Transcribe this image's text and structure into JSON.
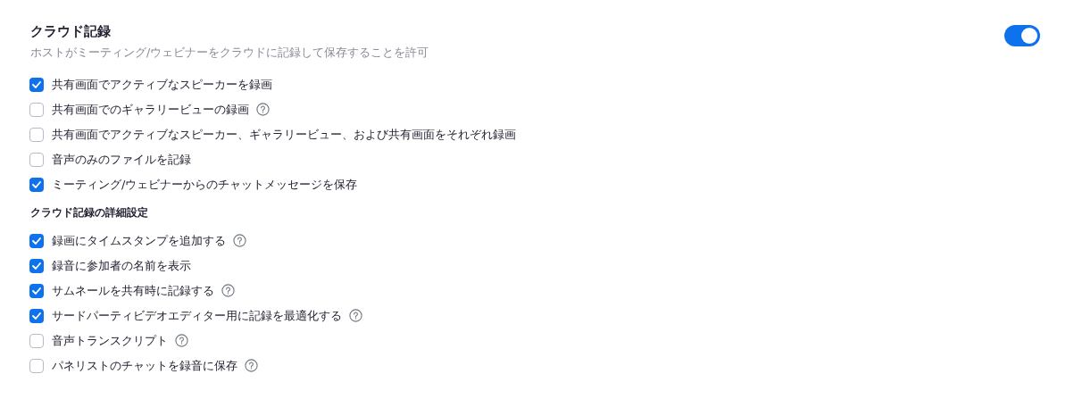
{
  "title": "クラウド記録",
  "description": "ホストがミーティング/ウェビナーをクラウドに記録して保存することを許可",
  "toggle": {
    "on": true
  },
  "options": [
    {
      "label": "共有画面でアクティブなスピーカーを録画",
      "checked": true,
      "help": false
    },
    {
      "label": "共有画面でのギャラリービューの録画",
      "checked": false,
      "help": true
    },
    {
      "label": "共有画面でアクティブなスピーカー、ギャラリービュー、および共有画面をそれぞれ録画",
      "checked": false,
      "help": false
    },
    {
      "label": "音声のみのファイルを記録",
      "checked": false,
      "help": false
    },
    {
      "label": "ミーティング/ウェビナーからのチャットメッセージを保存",
      "checked": true,
      "help": false
    }
  ],
  "advanced": {
    "heading": "クラウド記録の詳細設定",
    "options": [
      {
        "label": "録画にタイムスタンプを追加する",
        "checked": true,
        "help": true
      },
      {
        "label": "録音に参加者の名前を表示",
        "checked": true,
        "help": false
      },
      {
        "label": "サムネールを共有時に記録する",
        "checked": true,
        "help": true
      },
      {
        "label": "サードパーティビデオエディター用に記録を最適化する",
        "checked": true,
        "help": true
      },
      {
        "label": "音声トランスクリプト",
        "checked": false,
        "help": true
      },
      {
        "label": "パネリストのチャットを録音に保存",
        "checked": false,
        "help": true
      }
    ]
  }
}
